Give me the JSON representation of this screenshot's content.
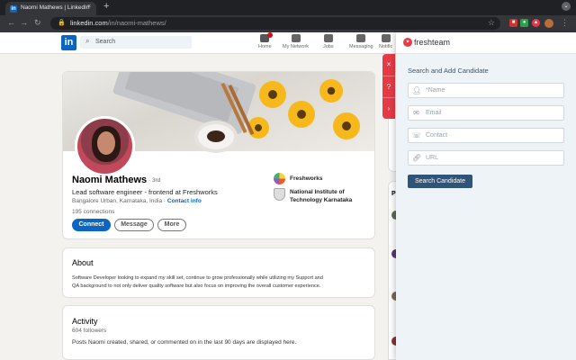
{
  "browser": {
    "tab_title": "Naomi Mathews | LinkedIn",
    "tab_close": "×",
    "new_tab": "+",
    "url_host": "linkedin.com",
    "url_path": "/in/naomi-mathews/",
    "back": "←",
    "forward": "→",
    "reload": "C",
    "menu": "⋮"
  },
  "linkedin_nav": {
    "logo": "in",
    "search_placeholder": "Search",
    "items": [
      {
        "label": "Home",
        "color": "#666666"
      },
      {
        "label": "My Network",
        "color": "#666666"
      },
      {
        "label": "Jobs",
        "color": "#666666"
      },
      {
        "label": "Messaging",
        "color": "#666666"
      },
      {
        "label": "Notific",
        "color": "#666666"
      }
    ]
  },
  "profile": {
    "name": "Naomi Mathews",
    "degree": "· 3rd",
    "headline": "Lead software engineer - frontend at Freshworks",
    "location": "Bangalore Urban, Karnataka, India ·",
    "contact_info": "Contact info",
    "connections": "195 connections",
    "buttons": {
      "connect": "Connect",
      "message": "Message",
      "more": "More"
    },
    "company": "Freshworks",
    "school_line1": "National Institute of",
    "school_line2": "Technology Karnataka"
  },
  "about": {
    "heading": "About",
    "text_line1": "Software Developer looking to expand my skill set, continue to grow professionally while utilizing my Support and",
    "text_line2": "QA background to not only deliver quality software but also focus on improving the overall customer experience."
  },
  "activity": {
    "heading": "Activity",
    "followers": "604 followers",
    "text": "Posts Naomi created, shared, or commented on in the last 90 days are displayed here."
  },
  "freshteam": {
    "brand": "freshteam",
    "panel_title": "Search and Add Candidate",
    "fields": [
      {
        "placeholder": "*Name",
        "icon": "person-icon"
      },
      {
        "placeholder": "Email",
        "icon": "mail-icon"
      },
      {
        "placeholder": "Contact",
        "icon": "phone-icon"
      },
      {
        "placeholder": "URL",
        "icon": "link-icon"
      }
    ],
    "search_button": "Search Candidate",
    "side_buttons": [
      "×",
      "?",
      "›"
    ]
  },
  "colors": {
    "linkedin_blue": "#0a66c2",
    "freshteam_red": "#e63b47",
    "freshteam_button": "#2f5478"
  }
}
